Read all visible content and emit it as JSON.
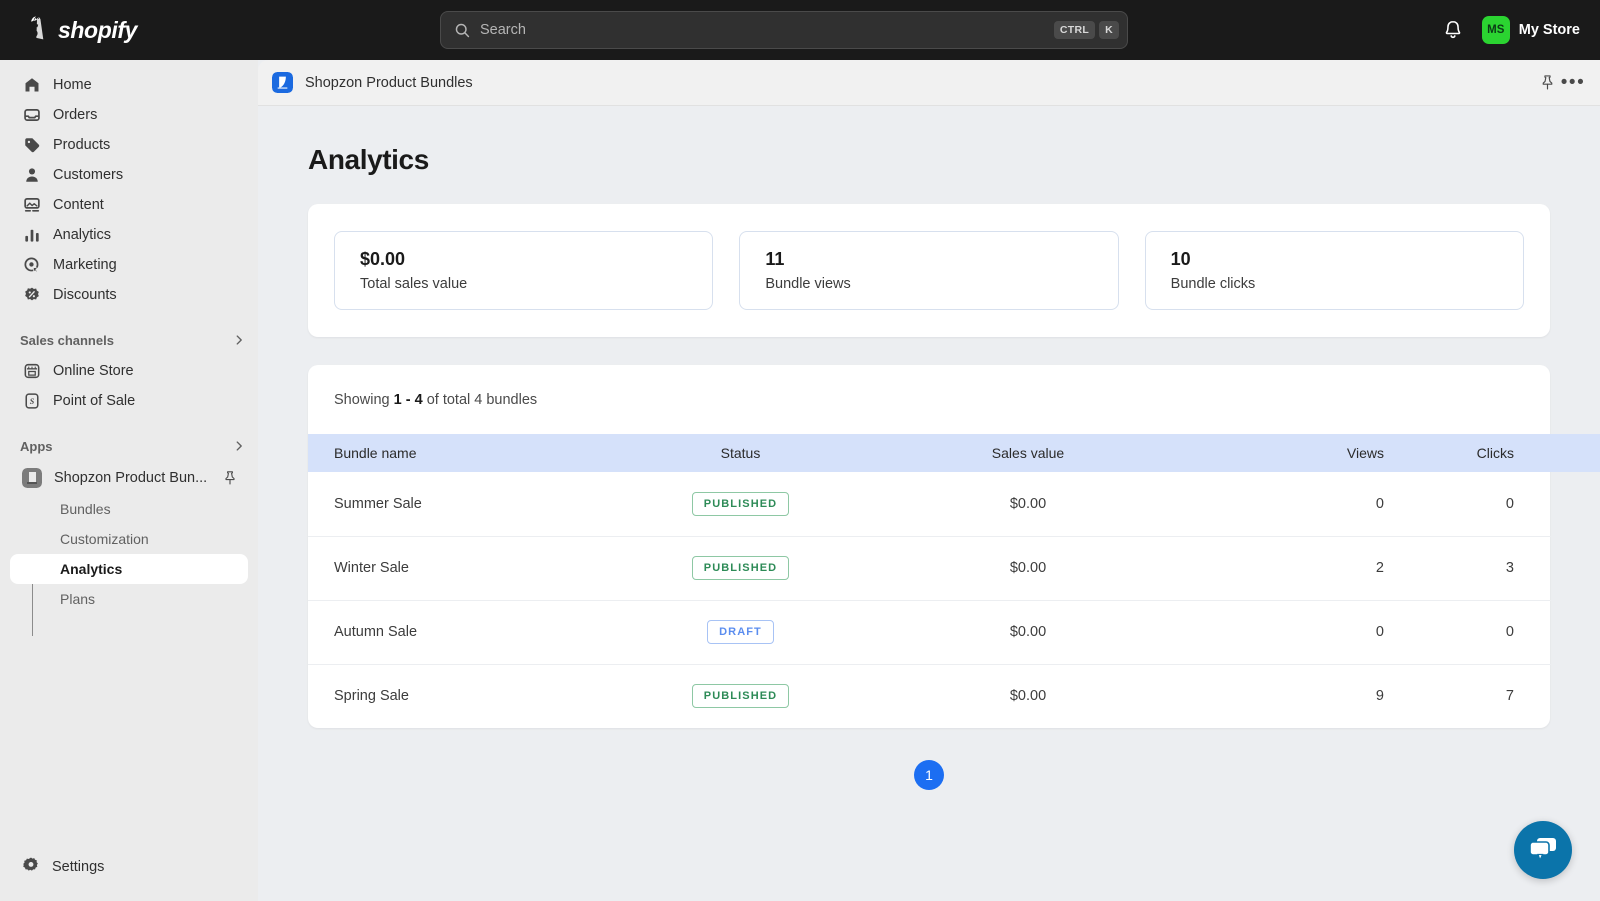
{
  "topbar": {
    "logo_text": "shopify",
    "search": {
      "placeholder": "Search",
      "kbd_ctrl": "CTRL",
      "kbd_key": "K"
    },
    "store": {
      "initials": "MS",
      "name": "My Store"
    },
    "accent_green": "#2bd431",
    "background": "#1a1a1a"
  },
  "sidebar": {
    "items": [
      {
        "label": "Home",
        "icon": "home-icon"
      },
      {
        "label": "Orders",
        "icon": "orders-icon"
      },
      {
        "label": "Products",
        "icon": "products-tag-icon"
      },
      {
        "label": "Customers",
        "icon": "customers-person-icon"
      },
      {
        "label": "Content",
        "icon": "content-image-icon"
      },
      {
        "label": "Analytics",
        "icon": "analytics-bars-icon"
      },
      {
        "label": "Marketing",
        "icon": "marketing-target-icon"
      },
      {
        "label": "Discounts",
        "icon": "discounts-badge-icon"
      }
    ],
    "sales_channels": {
      "title": "Sales channels",
      "items": [
        {
          "label": "Online Store",
          "icon": "online-store-icon"
        },
        {
          "label": "Point of Sale",
          "icon": "point-of-sale-icon"
        }
      ]
    },
    "apps": {
      "title": "Apps",
      "app_name": "Shopzon Product Bun...",
      "sub_items": [
        {
          "label": "Bundles",
          "active": false
        },
        {
          "label": "Customization",
          "active": false
        },
        {
          "label": "Analytics",
          "active": true
        },
        {
          "label": "Plans",
          "active": false
        }
      ]
    },
    "settings": {
      "label": "Settings",
      "icon": "gear-icon"
    }
  },
  "app_header": {
    "title": "Shopzon Product Bundles",
    "pin_icon": "pin-icon",
    "more_icon": "more-horizontal-icon"
  },
  "main": {
    "page_title": "Analytics",
    "metrics": [
      {
        "value": "$0.00",
        "label": "Total sales value"
      },
      {
        "value": "11",
        "label": "Bundle views"
      },
      {
        "value": "10",
        "label": "Bundle clicks"
      }
    ],
    "showing": {
      "prefix": "Showing ",
      "range": "1 - 4",
      "suffix": " of total 4 bundles"
    },
    "table": {
      "columns": [
        "Bundle name",
        "Status",
        "Sales value",
        "Views",
        "Clicks"
      ],
      "header_bg": "#d5e1fa",
      "rows": [
        {
          "name": "Summer Sale",
          "status": "PUBLISHED",
          "status_kind": "published",
          "sales": "$0.00",
          "views": "0",
          "clicks": "0"
        },
        {
          "name": "Winter Sale",
          "status": "PUBLISHED",
          "status_kind": "published",
          "sales": "$0.00",
          "views": "2",
          "clicks": "3"
        },
        {
          "name": "Autumn Sale",
          "status": "DRAFT",
          "status_kind": "draft",
          "sales": "$0.00",
          "views": "0",
          "clicks": "0"
        },
        {
          "name": "Spring Sale",
          "status": "PUBLISHED",
          "status_kind": "published",
          "sales": "$0.00",
          "views": "9",
          "clicks": "7"
        }
      ]
    },
    "pagination": {
      "current": "1"
    },
    "chat": {
      "icon": "chat-bubbles-icon",
      "color": "#0b74aa"
    }
  }
}
